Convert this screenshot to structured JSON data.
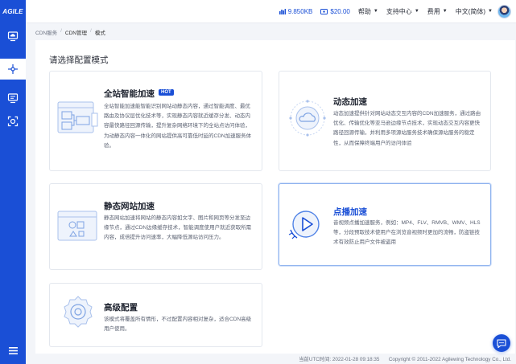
{
  "brand": {
    "logo": "AGILE"
  },
  "topbar": {
    "traffic": "9.850KB",
    "balance": "$20.00",
    "help": "帮助",
    "support": "支持中心",
    "billing": "费用",
    "language": "中文(简体)"
  },
  "breadcrumb": [
    "CDN服务",
    "CDN管理",
    "模式"
  ],
  "page": {
    "title": "请选择配置模式"
  },
  "cards": [
    {
      "title": "全站智能加速",
      "badge": "HOT",
      "desc": "全站智能加速能智能识别网站动静态内容，通过智能调度、最优路由及协议层优化技术等，实现静态内容就近缓存分发、动态内容最快路径回源传输，提升复杂网络环境下的全站点访问体验，为动静态内容一体化的网站提供高可靠低时延的CDN加速服务体验。"
    },
    {
      "title": "动态加速",
      "desc": "动态加速提供针对网站动态交互内容的CDN加速服务，通过路由优化、传输优化等亚马逊边缘节点技术，实现动态交互内容更快路径回源传输，并利用多项源站服务技术确保源站服务的稳定性，从而保障终端用户的访问体验"
    },
    {
      "title": "静态网站加速",
      "desc": "静态网站加速将网站的静态内容如文字、图片和网页等分发至边缘节点，通过CDN边缘缓存技术，智能调度使用户就近获取所需内容，成倍提升访问速率，大幅降低源站访问压力。"
    },
    {
      "title": "点播加速",
      "desc": "音视频点播加速服务，例如：MP4、FLV、RMVB、WMV、HLS 等，分段预取技术使用户在浏览音视频时更加的流畅，防盗链技术有效防止用户文件被盗用"
    },
    {
      "title": "高级配置",
      "desc": "该模式将覆盖所有情形，不过配置内容相对复杂，适合CDN高级用户使用。"
    }
  ],
  "footer": {
    "time": "当前UTC时间: 2022-01-28 09:18:35",
    "copyright": "Copyright © 2011-2022 Agilewing Technology Co., Ltd."
  },
  "colors": {
    "primary": "#1a4fd6",
    "background": "#f3f5f9",
    "card_border": "#e3e7ee"
  },
  "icons": [
    "chart-icon",
    "wallet-icon",
    "caret-down-icon",
    "menu-icon",
    "chat-icon"
  ]
}
